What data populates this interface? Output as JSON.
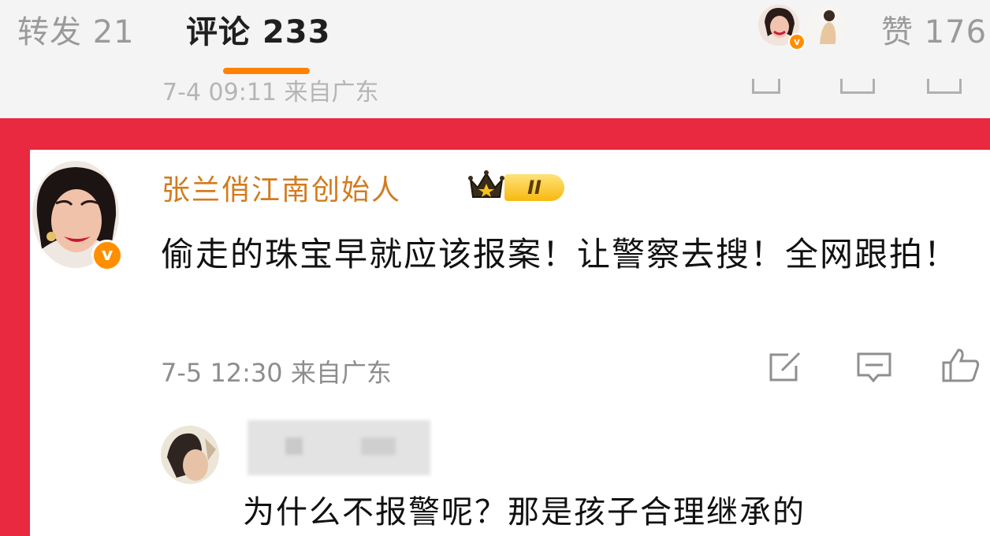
{
  "tabs": {
    "repost_label": "转发 21",
    "comment_label": "评论 233",
    "like_label": "赞 176"
  },
  "previous_comment": {
    "meta": "7-4 09:11 来自广东"
  },
  "comment": {
    "username": "张兰俏江南创始人",
    "level_badge": "II",
    "verified_badge": "v",
    "text": "偷走的珠宝早就应该报案！让警察去搜！全网跟拍！",
    "meta": "7-5 12:30 来自广东"
  },
  "reply": {
    "text": "为什么不报警呢？那是孩子合理继承的"
  },
  "colors": {
    "accent": "#ff8200",
    "highlight_frame": "#e8293f",
    "username": "#d27b1f",
    "verified": "#ff8f00"
  },
  "icons": [
    "share-icon",
    "comment-icon",
    "like-icon",
    "crown-icon",
    "verified-icon"
  ]
}
